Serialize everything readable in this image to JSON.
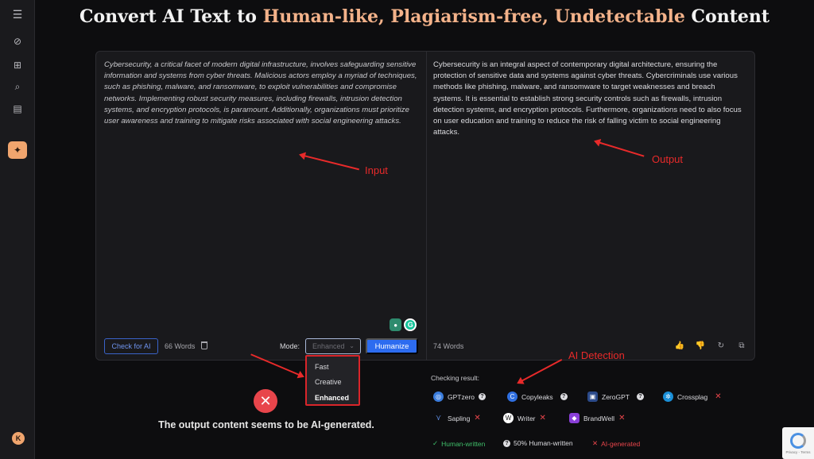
{
  "header": {
    "title_prefix": "Convert AI Text to ",
    "title_hl1": "Human-like,",
    "title_hl2": " Plagiarism-free,",
    "title_hl3": " Undetectable",
    "title_suffix": " Content"
  },
  "sidebar": {
    "items": [
      "menu-icon",
      "history-icon",
      "add-icon",
      "search-doc-icon",
      "document-icon",
      "sparkle-icon"
    ],
    "avatar_letter": "K"
  },
  "input": {
    "text": "Cybersecurity, a critical facet of modern digital infrastructure, involves safeguarding sensitive information and systems from cyber threats. Malicious actors employ a myriad of techniques, such as phishing, malware, and ransomware, to exploit vulnerabilities and compromise networks. Implementing robust security measures, including firewalls, intrusion detection systems, and encryption protocols, is paramount. Additionally, organizations must prioritize user awareness and training to mitigate risks associated with social engineering attacks.",
    "check_btn": "Check for AI",
    "word_count": "66 Words",
    "mode_label": "Mode:",
    "mode_value": "Enhanced",
    "humanize_btn": "Humanize"
  },
  "output": {
    "text": "Cybersecurity is an integral aspect of contemporary digital architecture, ensuring the protection of sensitive data and systems against cyber threats. Cybercriminals use various methods like phishing, malware, and ransomware to target weaknesses and breach systems. It is essential to establish strong security controls such as firewalls, intrusion detection systems, and encryption protocols. Furthermore, organizations need to also focus on user education and training to reduce the risk of falling victim to social engineering attacks.",
    "word_count": "74 Words"
  },
  "mode_dropdown": {
    "options": [
      "Fast",
      "Creative",
      "Enhanced"
    ],
    "selected": "Enhanced"
  },
  "result": {
    "message": "The output content seems to be AI-generated.",
    "checking_label": "Checking result:",
    "detectors": [
      {
        "name": "GPTzero",
        "status": "?"
      },
      {
        "name": "Copyleaks",
        "status": "?"
      },
      {
        "name": "ZeroGPT",
        "status": "?"
      },
      {
        "name": "Crossplag",
        "status": "✕"
      },
      {
        "name": "Sapling",
        "status": "✕"
      },
      {
        "name": "Writer",
        "status": "✕"
      },
      {
        "name": "BrandWell",
        "status": "✕"
      }
    ],
    "legend": {
      "human": "Human-written",
      "half": "50% Human-written",
      "ai": "AI-generated"
    }
  },
  "annotations": {
    "input": "Input",
    "output": "Output",
    "ai_detection": "AI Detection"
  },
  "recaptcha": {
    "text": "Privacy - Terms"
  },
  "colors": {
    "accent": "#f3b28a",
    "primary_button": "#2d6cf0",
    "annotation_red": "#e82a2a",
    "error": "#e8454b",
    "human_green": "#3fbf6a"
  }
}
